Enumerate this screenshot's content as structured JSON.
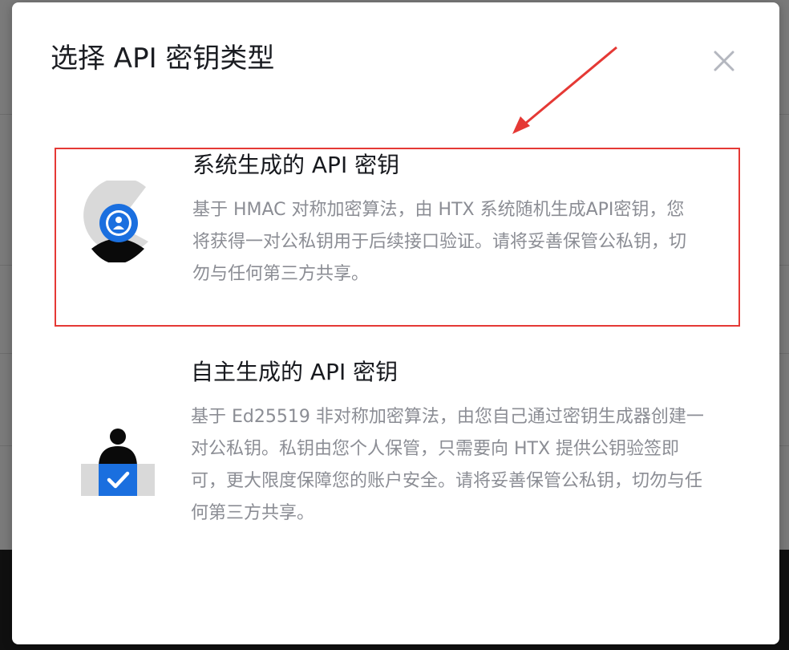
{
  "modal": {
    "title": "选择 API 密钥类型",
    "close_icon": "close-icon"
  },
  "options": [
    {
      "title": "系统生成的 API 密钥",
      "description": "基于 HMAC 对称加密算法，由 HTX 系统随机生成API密钥，您将获得一对公私钥用于后续接口验证。请将妥善保管公私钥，切勿与任何第三方共享。",
      "icon": "system-key-icon",
      "highlighted": true
    },
    {
      "title": "自主生成的 API 密钥",
      "description": "基于 Ed25519 非对称加密算法，由您自己通过密钥生成器创建一对公私钥。私钥由您个人保管，只需要向 HTX 提供公钥验签即可，更大限度保障您的账户安全。请将妥善保管公私钥，切勿与任何第三方共享。",
      "icon": "self-generated-key-icon",
      "highlighted": false
    }
  ],
  "colors": {
    "highlight_border": "#e53935",
    "accent_blue": "#1a6fdf",
    "title_text": "#17191e",
    "description_text": "#8b8d94"
  }
}
